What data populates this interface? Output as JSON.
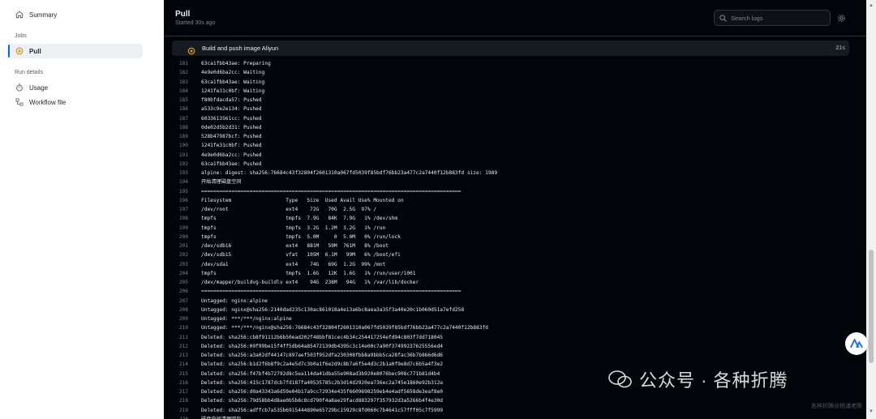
{
  "sidebar": {
    "summary": "Summary",
    "jobs_heading": "Jobs",
    "pull": "Pull",
    "run_details_heading": "Run details",
    "usage": "Usage",
    "workflow_file": "Workflow file"
  },
  "header": {
    "title": "Pull",
    "subtitle": "Started 30s ago",
    "search_placeholder": "Search logs"
  },
  "step": {
    "title": "Build and push image Aliyun",
    "duration": "21s"
  },
  "log": [
    {
      "n": "181",
      "t": "63ca1fbb43ae: Preparing"
    },
    {
      "n": "182",
      "t": "4e9e0d6ba2cc: Waiting"
    },
    {
      "n": "183",
      "t": "63ca1fbb43ae: Waiting"
    },
    {
      "n": "184",
      "t": "1241fe31c0bf: Waiting"
    },
    {
      "n": "185",
      "t": "f80bfdacda57: Pushed"
    },
    {
      "n": "186",
      "t": "a533c9e2e134: Pushed"
    },
    {
      "n": "187",
      "t": "6033613561cc: Pushed"
    },
    {
      "n": "188",
      "t": "0de02d5b2d31: Pushed"
    },
    {
      "n": "189",
      "t": "528b47987bcf: Pushed"
    },
    {
      "n": "190",
      "t": "1241fe31c0bf: Pushed"
    },
    {
      "n": "191",
      "t": "4e9e0d6ba2cc: Pushed"
    },
    {
      "n": "192",
      "t": "63ca1fbb43ae: Pushed"
    },
    {
      "n": "193",
      "t": "alpine: digest: sha256:76684c43f32804f2601310a067fd5039f85bdf76bb23a477c2a7440f12b883fd size: 1989"
    },
    {
      "n": "194",
      "t": "开始清理磁盘空间"
    },
    {
      "n": "195",
      "t": "======================================================================================"
    },
    {
      "n": "196",
      "t": "Filesystem                  Type   Size  Used Avail Use% Mounted on"
    },
    {
      "n": "197",
      "t": "/dev/root                   ext4    72G   70G  2.5G  97% /"
    },
    {
      "n": "198",
      "t": "tmpfs                       tmpfs  7.9G   84K  7.9G   1% /dev/shm"
    },
    {
      "n": "199",
      "t": "tmpfs                       tmpfs  3.2G  1.2M  3.2G   1% /run"
    },
    {
      "n": "200",
      "t": "tmpfs                       tmpfs  5.0M     0  5.0M   0% /run/lock"
    },
    {
      "n": "201",
      "t": "/dev/sdb16                  ext4   881M   59M  761M   8% /boot"
    },
    {
      "n": "202",
      "t": "/dev/sdb15                  vfat   105M  6.1M   99M   6% /boot/efi"
    },
    {
      "n": "203",
      "t": "/dev/sda1                   ext4    74G   69G  1.2G  99% /mnt"
    },
    {
      "n": "204",
      "t": "tmpfs                       tmpfs  1.6G   12K  1.6G   1% /run/user/1001"
    },
    {
      "n": "205",
      "t": "/dev/mapper/buildvg-buildlv ext4    94G  238M   94G   1% /var/lib/docker"
    },
    {
      "n": "206",
      "t": "======================================================================================"
    },
    {
      "n": "207",
      "t": "Untagged: nginx:alpine"
    },
    {
      "n": "208",
      "t": "Untagged: nginx@sha256:2140dad235c130ac861018a4e13a6bc8aea3a35f3a40e20c1b060d51a7efd258"
    },
    {
      "n": "209",
      "t": "Untagged: ***/***/nginx:alpine"
    },
    {
      "n": "210",
      "t": "Untagged: ***/***/nginx@sha256:76684c43f32804f2601310a067fd5039f85bdf76bb23a477c2a7440f12b883fd"
    },
    {
      "n": "211",
      "t": "Deleted: sha256:cb8f91112b6b50ead202f48bbf81cec4b34c254417254efd94c803f7dd718045"
    },
    {
      "n": "212",
      "t": "Deleted: sha256:09f99be15f4ff5db64a85472139db4395c3c14e00c7a90f37499237625556ed4"
    },
    {
      "n": "213",
      "t": "Deleted: sha256:a3a02df44147c897aef503f952dfa230308fbb8a9bbb5ca28fac36b7b866d6d6"
    },
    {
      "n": "214",
      "t": "Deleted: sha256:b1d2f6b8f9c2a4e5d7c3b0a1f6e2d9c8b7a6f5e4d3c2b1a0f9e8d7c6b5a4f3e2"
    },
    {
      "n": "215",
      "t": "Deleted: sha256:f47bf4b72792d8c5ea114da41dba55e908ad3b920e8076bec908c771b81d4b4"
    },
    {
      "n": "216",
      "t": "Deleted: sha256:415c1787dcb7fd187fa40535785c2b3d14d2920ea736ec2a745e1860e92b312a"
    },
    {
      "n": "217",
      "t": "Deleted: sha256:d0a43343a6d59e04b17a9cc72934e435f6609698259eb4e4adf5658de3eaf8e0"
    },
    {
      "n": "218",
      "t": "Deleted: sha256:79d58bb4d8ae0b5b8c8cd790f4a8ae29facd883297f357932d3a5266b4f4e30d"
    },
    {
      "n": "219",
      "t": "Deleted: sha256:adffcb7a535b6915444890e65729bc15929c8fd060c7b4641c57fff05c7f5999"
    },
    {
      "n": "220",
      "t": "磁盘空间清理完毕"
    }
  ],
  "watermark": {
    "text": "公众号 · 各种折腾",
    "sub": "各种折腾@杨浦老陈"
  },
  "colors": {
    "log_bg": "#010409",
    "step_bg": "#161b22",
    "status_yellow": "#d29922",
    "text": "#e6edf3",
    "muted": "#7d8590"
  }
}
